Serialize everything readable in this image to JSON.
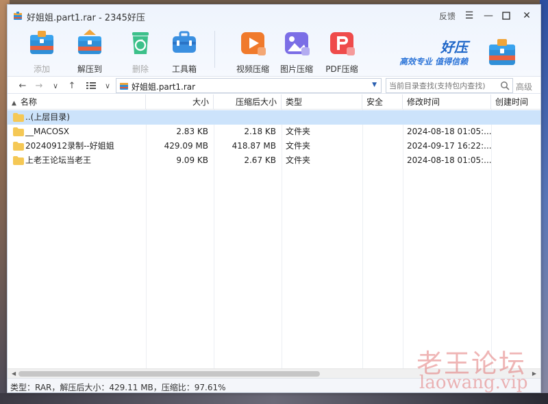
{
  "window": {
    "title": "好姐姐.part1.rar - 2345好压",
    "feedback": "反馈"
  },
  "toolbar": {
    "add": "添加",
    "extract": "解压到",
    "delete": "删除",
    "toolbox": "工具箱",
    "video": "视频压缩",
    "image": "图片压缩",
    "pdf": "PDF压缩"
  },
  "brand": {
    "name": "好压",
    "slogan": "高效专业  值得信赖"
  },
  "nav": {
    "path": "好姐姐.part1.rar",
    "search_placeholder": "当前目录查找(支持包内查找)",
    "advanced": "高级"
  },
  "columns": {
    "name": "名称",
    "size": "大小",
    "packed": "压缩后大小",
    "type": "类型",
    "secure": "安全",
    "modified": "修改时间",
    "created": "创建时间"
  },
  "rows": [
    {
      "name": "..(上层目录)",
      "size": "",
      "packed": "",
      "type": "",
      "secure": "",
      "modified": "",
      "created": ""
    },
    {
      "name": "__MACOSX",
      "size": "2.83 KB",
      "packed": "2.18 KB",
      "type": "文件夹",
      "secure": "",
      "modified": "2024-08-18 01:05:...",
      "created": ""
    },
    {
      "name": "20240912录制--好姐姐",
      "size": "429.09 MB",
      "packed": "418.87 MB",
      "type": "文件夹",
      "secure": "",
      "modified": "2024-09-17 16:22:...",
      "created": ""
    },
    {
      "name": "上老王论坛当老王",
      "size": "9.09 KB",
      "packed": "2.67 KB",
      "type": "文件夹",
      "secure": "",
      "modified": "2024-08-18 01:05:...",
      "created": ""
    }
  ],
  "status": {
    "text": "类型：RAR，解压后大小：429.11 MB，压缩比：97.61%"
  },
  "watermark": {
    "cn": "老王论坛",
    "en": "laowang.vip"
  }
}
